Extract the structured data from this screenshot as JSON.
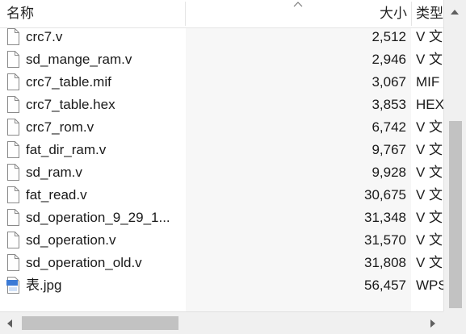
{
  "columns": {
    "name": "名称",
    "size": "大小",
    "type": "类型"
  },
  "files": [
    {
      "name": "crc7.v",
      "size": "2,512",
      "type": "V 文",
      "icon": "file-icon"
    },
    {
      "name": "sd_mange_ram.v",
      "size": "2,946",
      "type": "V 文",
      "icon": "file-icon"
    },
    {
      "name": "crc7_table.mif",
      "size": "3,067",
      "type": "MIF",
      "icon": "file-icon"
    },
    {
      "name": "crc7_table.hex",
      "size": "3,853",
      "type": "HEX",
      "icon": "file-icon"
    },
    {
      "name": "crc7_rom.v",
      "size": "6,742",
      "type": "V 文",
      "icon": "file-icon"
    },
    {
      "name": "fat_dir_ram.v",
      "size": "9,767",
      "type": "V 文",
      "icon": "file-icon"
    },
    {
      "name": "sd_ram.v",
      "size": "9,928",
      "type": "V 文",
      "icon": "file-icon"
    },
    {
      "name": "fat_read.v",
      "size": "30,675",
      "type": "V 文",
      "icon": "file-icon"
    },
    {
      "name": "sd_operation_9_29_1...",
      "size": "31,348",
      "type": "V 文",
      "icon": "file-icon"
    },
    {
      "name": "sd_operation.v",
      "size": "31,570",
      "type": "V 文",
      "icon": "file-icon"
    },
    {
      "name": "sd_operation_old.v",
      "size": "31,808",
      "type": "V 文",
      "icon": "file-icon"
    },
    {
      "name": "表.jpg",
      "size": "56,457",
      "type": "WPS",
      "icon": "image-file-icon"
    }
  ],
  "sort": {
    "column": "size",
    "direction": "ascending",
    "icon": "sort-up-icon"
  },
  "colors": {
    "shade": "#f7f7f7",
    "scrollbar_track": "#f0f0f0",
    "scrollbar_thumb": "#c2c2c2"
  }
}
